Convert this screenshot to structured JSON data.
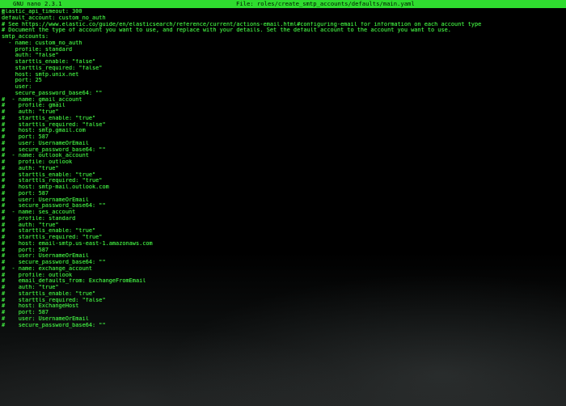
{
  "window": {
    "app_version": "GNU nano 2.3.1",
    "file_title": "File: roles/create_smtp_accounts/defaults/main.yaml"
  },
  "editor": {
    "lines": [
      "elastic_api_timeout: 300",
      "default_account: custom_no_auth",
      "# See https://www.elastic.co/guide/en/elasticsearch/reference/current/actions-email.html#configuring-email for information on each account type",
      "# Document the type of account you want to use, and replace with your details. Set the default account to the account you want to use.",
      "smtp_accounts:",
      "  - name: custom_no_auth",
      "    profile: standard",
      "    auth: \"false\"",
      "    starttls_enable: \"false\"",
      "    starttls_required: \"false\"",
      "    host: smtp.unix.net",
      "    port: 25",
      "    user:",
      "    secure_password_base64: \"\"",
      "#  - name: gmail_account",
      "#    profile: gmail",
      "#    auth: \"true\"",
      "#    starttls_enable: \"true\"",
      "#    starttls_required: \"false\"",
      "#    host: smtp.gmail.com",
      "#    port: 587",
      "#    user: UsernameOrEmail",
      "#    secure_password_base64: \"\"",
      "#  - name: outlook_account",
      "#    profile: outlook",
      "#    auth: \"true\"",
      "#    starttls_enable: \"true\"",
      "#    starttls_required: \"true\"",
      "#    host: smtp-mail.outlook.com",
      "#    port: 587",
      "#    user: UsernameOrEmail",
      "#    secure_password_base64: \"\"",
      "#  - name: ses_account",
      "#    profile: standard",
      "#    auth: \"true\"",
      "#    starttls_enable: \"true\"",
      "#    starttls_required: \"true\"",
      "#    host: email-smtp.us-east-1.amazonaws.com",
      "#    port: 587",
      "#    user: UsernameOrEmail",
      "#    secure_password_base64: \"\"",
      "#  - name: exchange_account",
      "#    profile: outlook",
      "#    email_defaults_from: ExchangeFromEmail",
      "#    auth: \"true\"",
      "#    starttls_enable: \"true\"",
      "#    starttls_required: \"false\"",
      "#    host: ExchangeHost",
      "#    port: 587",
      "#    user: UsernameOrEmail",
      "#    secure_password_base64: \"\""
    ]
  }
}
